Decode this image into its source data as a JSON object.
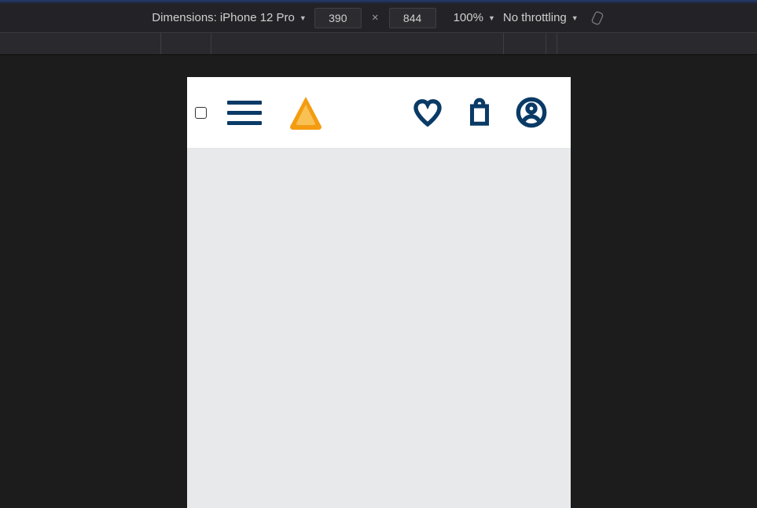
{
  "toolbar": {
    "dimensions_label": "Dimensions:",
    "device_name": "iPhone 12 Pro",
    "width": "390",
    "height": "844",
    "dim_sep": "×",
    "zoom": "100%",
    "throttling": "No throttling"
  },
  "colors": {
    "brand_dark": "#0a3a66",
    "logo_orange": "#f39c12",
    "logo_inner": "#f9c154"
  }
}
